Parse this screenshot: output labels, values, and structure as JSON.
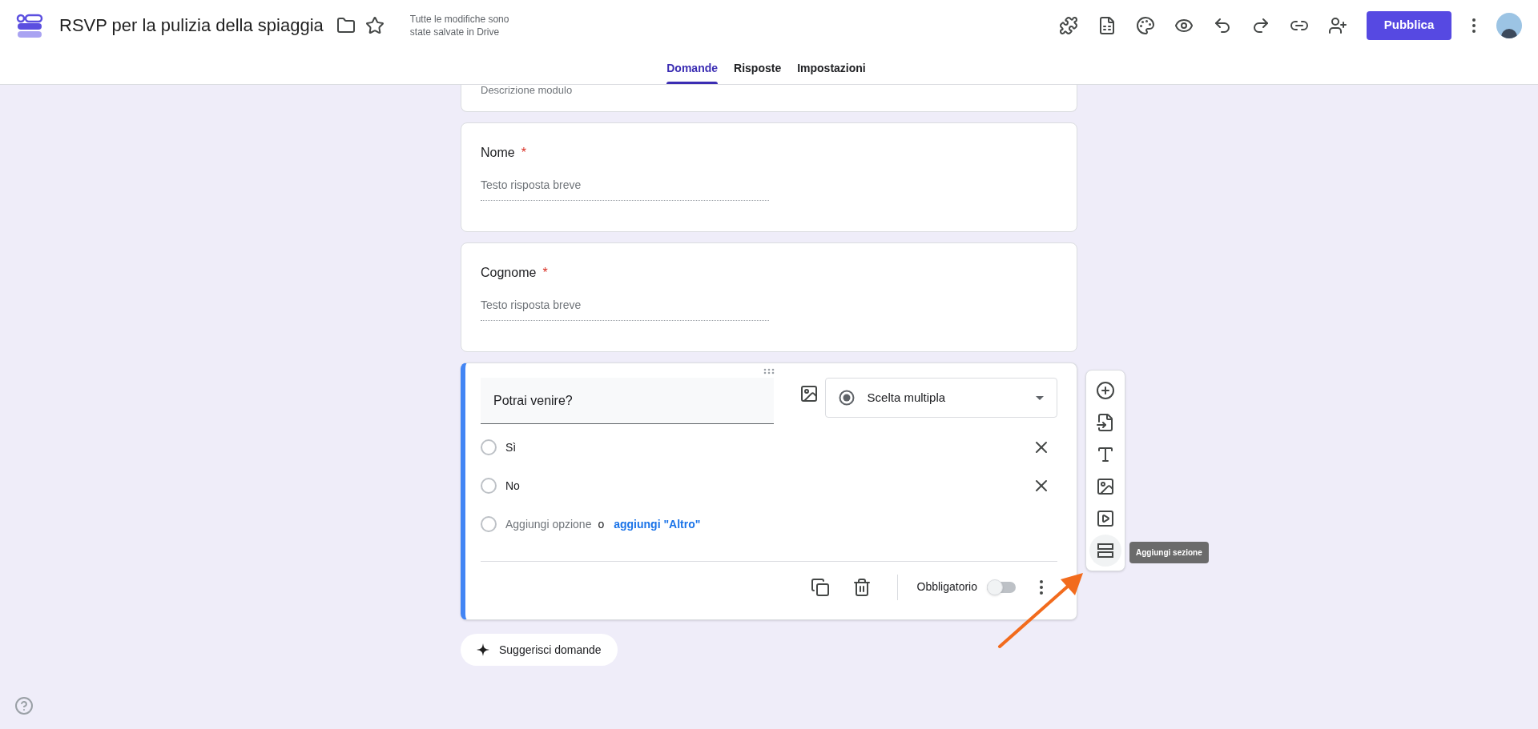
{
  "header": {
    "title": "RSVP per la pulizia della spiaggia",
    "save_status": "Tutte le modifiche sono state salvate in Drive",
    "publish_button": "Pubblica"
  },
  "tabs": [
    {
      "label": "Domande",
      "selected": true
    },
    {
      "label": "Risposte",
      "selected": false
    },
    {
      "label": "Impostazioni",
      "selected": false
    }
  ],
  "form_description": "Descrizione modulo",
  "questions": [
    {
      "title": "Nome",
      "required_mark": "*",
      "placeholder": "Testo risposta breve"
    },
    {
      "title": "Cognome",
      "required_mark": "*",
      "placeholder": "Testo risposta breve"
    }
  ],
  "active_question": {
    "title": "Potrai venire?",
    "type": "Scelta multipla",
    "options": [
      {
        "label": "Sì",
        "selected": false
      },
      {
        "label": "No",
        "selected": false
      }
    ],
    "add_option": "Aggiungi opzione",
    "or": "o",
    "add_other": "aggiungi \"Altro\"",
    "required_label": "Obbligatorio",
    "required": false
  },
  "side_toolbar": {
    "tooltip": "Aggiungi sezione"
  },
  "suggest_button": "Suggerisci domande"
}
